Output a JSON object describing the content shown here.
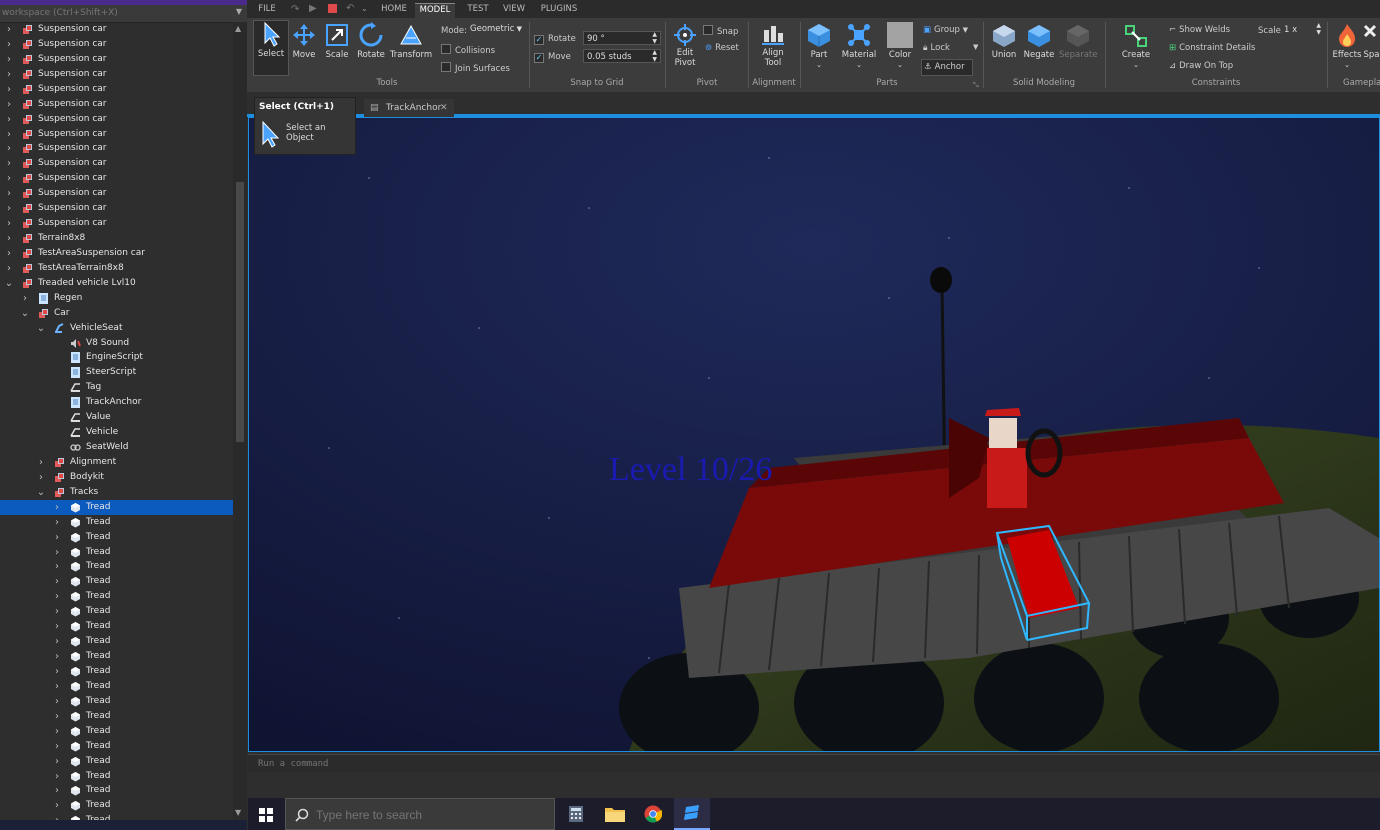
{
  "explorer": {
    "filter_placeholder": "workspace (Ctrl+Shift+X)",
    "rows": [
      {
        "label": "Suspension car",
        "depth": 0,
        "arrow": "right",
        "icon": "model"
      },
      {
        "label": "Suspension car",
        "depth": 0,
        "arrow": "right",
        "icon": "model"
      },
      {
        "label": "Suspension car",
        "depth": 0,
        "arrow": "right",
        "icon": "model"
      },
      {
        "label": "Suspension car",
        "depth": 0,
        "arrow": "right",
        "icon": "model"
      },
      {
        "label": "Suspension car",
        "depth": 0,
        "arrow": "right",
        "icon": "model"
      },
      {
        "label": "Suspension car",
        "depth": 0,
        "arrow": "right",
        "icon": "model"
      },
      {
        "label": "Suspension car",
        "depth": 0,
        "arrow": "right",
        "icon": "model"
      },
      {
        "label": "Suspension car",
        "depth": 0,
        "arrow": "right",
        "icon": "model"
      },
      {
        "label": "Suspension car",
        "depth": 0,
        "arrow": "right",
        "icon": "model"
      },
      {
        "label": "Suspension car",
        "depth": 0,
        "arrow": "right",
        "icon": "model"
      },
      {
        "label": "Suspension car",
        "depth": 0,
        "arrow": "right",
        "icon": "model"
      },
      {
        "label": "Suspension car",
        "depth": 0,
        "arrow": "right",
        "icon": "model"
      },
      {
        "label": "Suspension car",
        "depth": 0,
        "arrow": "right",
        "icon": "model"
      },
      {
        "label": "Suspension car",
        "depth": 0,
        "arrow": "right",
        "icon": "model"
      },
      {
        "label": "Terrain8x8",
        "depth": 0,
        "arrow": "right",
        "icon": "model"
      },
      {
        "label": "TestAreaSuspension car",
        "depth": 0,
        "arrow": "right",
        "icon": "model"
      },
      {
        "label": "TestAreaTerrain8x8",
        "depth": 0,
        "arrow": "right",
        "icon": "model"
      },
      {
        "label": "Treaded vehicle Lvl10",
        "depth": 0,
        "arrow": "down",
        "icon": "model"
      },
      {
        "label": "Regen",
        "depth": 1,
        "arrow": "right",
        "icon": "script"
      },
      {
        "label": "Car",
        "depth": 1,
        "arrow": "down",
        "icon": "model"
      },
      {
        "label": "VehicleSeat",
        "depth": 2,
        "arrow": "down",
        "icon": "seat"
      },
      {
        "label": "V8 Sound",
        "depth": 3,
        "arrow": "",
        "icon": "sound"
      },
      {
        "label": "EngineScript",
        "depth": 3,
        "arrow": "",
        "icon": "script"
      },
      {
        "label": "SteerScript",
        "depth": 3,
        "arrow": "",
        "icon": "script"
      },
      {
        "label": "Tag",
        "depth": 3,
        "arrow": "",
        "icon": "value"
      },
      {
        "label": "TrackAnchor",
        "depth": 3,
        "arrow": "",
        "icon": "script"
      },
      {
        "label": "Value",
        "depth": 3,
        "arrow": "",
        "icon": "value"
      },
      {
        "label": "Vehicle",
        "depth": 3,
        "arrow": "",
        "icon": "value"
      },
      {
        "label": "SeatWeld",
        "depth": 3,
        "arrow": "",
        "icon": "weld"
      },
      {
        "label": "Alignment",
        "depth": 2,
        "arrow": "right",
        "icon": "model"
      },
      {
        "label": "Bodykit",
        "depth": 2,
        "arrow": "right",
        "icon": "model"
      },
      {
        "label": "Tracks",
        "depth": 2,
        "arrow": "down",
        "icon": "model"
      },
      {
        "label": "Tread",
        "depth": 3,
        "arrow": "right",
        "icon": "union",
        "selected": true
      },
      {
        "label": "Tread",
        "depth": 3,
        "arrow": "right",
        "icon": "union"
      },
      {
        "label": "Tread",
        "depth": 3,
        "arrow": "right",
        "icon": "union"
      },
      {
        "label": "Tread",
        "depth": 3,
        "arrow": "right",
        "icon": "union"
      },
      {
        "label": "Tread",
        "depth": 3,
        "arrow": "right",
        "icon": "union"
      },
      {
        "label": "Tread",
        "depth": 3,
        "arrow": "right",
        "icon": "union"
      },
      {
        "label": "Tread",
        "depth": 3,
        "arrow": "right",
        "icon": "union"
      },
      {
        "label": "Tread",
        "depth": 3,
        "arrow": "right",
        "icon": "union"
      },
      {
        "label": "Tread",
        "depth": 3,
        "arrow": "right",
        "icon": "union"
      },
      {
        "label": "Tread",
        "depth": 3,
        "arrow": "right",
        "icon": "union"
      },
      {
        "label": "Tread",
        "depth": 3,
        "arrow": "right",
        "icon": "union"
      },
      {
        "label": "Tread",
        "depth": 3,
        "arrow": "right",
        "icon": "union"
      },
      {
        "label": "Tread",
        "depth": 3,
        "arrow": "right",
        "icon": "union"
      },
      {
        "label": "Tread",
        "depth": 3,
        "arrow": "right",
        "icon": "union"
      },
      {
        "label": "Tread",
        "depth": 3,
        "arrow": "right",
        "icon": "union"
      },
      {
        "label": "Tread",
        "depth": 3,
        "arrow": "right",
        "icon": "union"
      },
      {
        "label": "Tread",
        "depth": 3,
        "arrow": "right",
        "icon": "union"
      },
      {
        "label": "Tread",
        "depth": 3,
        "arrow": "right",
        "icon": "union"
      },
      {
        "label": "Tread",
        "depth": 3,
        "arrow": "right",
        "icon": "union"
      },
      {
        "label": "Tread",
        "depth": 3,
        "arrow": "right",
        "icon": "union"
      },
      {
        "label": "Tread",
        "depth": 3,
        "arrow": "right",
        "icon": "union"
      },
      {
        "label": "Tread",
        "depth": 3,
        "arrow": "right",
        "icon": "union"
      },
      {
        "label": "Tread",
        "depth": 3,
        "arrow": "right",
        "icon": "union"
      }
    ]
  },
  "menu": {
    "tabs": [
      "FILE",
      "HOME",
      "MODEL",
      "TEST",
      "VIEW",
      "PLUGINS"
    ],
    "active_tab": "MODEL"
  },
  "ribbon": {
    "tools": {
      "select": "Select",
      "move": "Move",
      "scale": "Scale",
      "rotate": "Rotate",
      "transform": "Transform",
      "mode_label": "Mode:",
      "mode_value": "Geometric",
      "collisions": "Collisions",
      "join_surfaces": "Join Surfaces",
      "group": "Tools"
    },
    "snap": {
      "rotate_label": "Rotate",
      "rotate_value": "90 °",
      "move_label": "Move",
      "move_value": "0.05 studs",
      "group": "Snap to Grid"
    },
    "pivot": {
      "edit": "Edit",
      "edit2": "Pivot",
      "snap": "Snap",
      "reset": "Reset",
      "group": "Pivot"
    },
    "alignment": {
      "align": "Align",
      "align2": "Tool",
      "group": "Alignment"
    },
    "parts": {
      "part": "Part",
      "material": "Material",
      "color": "Color",
      "group_btn": "Group",
      "lock": "Lock",
      "anchor": "Anchor",
      "group": "Parts"
    },
    "solid": {
      "union": "Union",
      "negate": "Negate",
      "separate": "Separate",
      "group": "Solid Modeling"
    },
    "constraints": {
      "create": "Create",
      "show_welds": "Show Welds",
      "constraint_details": "Constraint Details",
      "draw_on_top": "Draw On Top",
      "scale_label": "Scale",
      "scale_value": "1 x",
      "group": "Constraints"
    },
    "gameplay": {
      "effects": "Effects",
      "spa": "Spa",
      "group": "Gamepla"
    }
  },
  "tooltip": {
    "title": "Select (Ctrl+1)",
    "body": "Select an Object"
  },
  "doc_tab": {
    "label": "TrackAnchor"
  },
  "viewport": {
    "level_text": "Level 10/26"
  },
  "command": {
    "placeholder": "Run a command"
  },
  "taskbar": {
    "search_placeholder": "Type here to search"
  },
  "colors": {
    "accent": "#0b5bbf",
    "viewport_border": "#1e8fe0",
    "selection_box": "#2fb7ff",
    "vehicle_red": "#8b0a0a"
  }
}
